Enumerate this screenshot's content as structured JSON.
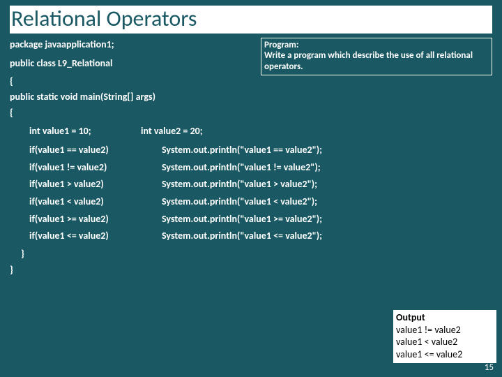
{
  "title": "Relational Operators",
  "note": {
    "heading": "Program:",
    "body": "Write a program which describe the use of all relational operators."
  },
  "code": {
    "pkg": "package javaapplication1;",
    "cls": "public class L9_Relational",
    "brace_open_1": "{",
    "main_sig": "public static void main(String[] args)",
    "brace_open_2": "{",
    "decl1": "int value1 = 10;",
    "decl2": "int value2 = 20;",
    "rows": [
      {
        "a": "if(value1 == value2)",
        "b": "System.out.println(\"value1 == value2\");"
      },
      {
        "a": "if(value1 != value2)",
        "b": "System.out.println(\"value1 != value2\");"
      },
      {
        "a": "if(value1 > value2)",
        "b": "System.out.println(\"value1 > value2\");"
      },
      {
        "a": "if(value1 < value2)",
        "b": "System.out.println(\"value1 < value2\");"
      },
      {
        "a": "if(value1 >= value2)",
        "b": "System.out.println(\"value1 >= value2\");"
      },
      {
        "a": "if(value1 <= value2)",
        "b": "System.out.println(\"value1 <= value2\");"
      }
    ],
    "brace_close_2": "}",
    "brace_close_1": "}"
  },
  "output": {
    "heading": "Output",
    "lines": [
      "value1 != value2",
      "value1 < value2",
      "value1 <= value2"
    ]
  },
  "page_number": "15"
}
